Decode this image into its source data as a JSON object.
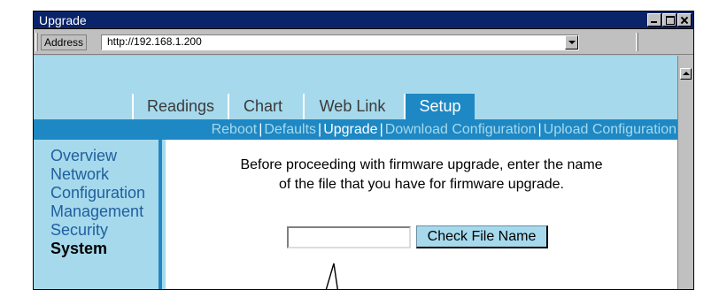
{
  "window": {
    "title": "Upgrade"
  },
  "address": {
    "label": "Address",
    "url": "http://192.168.1.200"
  },
  "tabs": [
    {
      "label": "Readings",
      "active": false
    },
    {
      "label": "Chart",
      "active": false
    },
    {
      "label": "Web Link",
      "active": false
    },
    {
      "label": "Setup",
      "active": true
    }
  ],
  "subnav": [
    {
      "label": "Reboot",
      "selected": false
    },
    {
      "label": "Defaults",
      "selected": false
    },
    {
      "label": "Upgrade",
      "selected": true
    },
    {
      "label": "Download Configuration",
      "selected": false
    },
    {
      "label": "Upload Configuration",
      "selected": false
    }
  ],
  "sidebar": {
    "items": [
      {
        "label": "Overview"
      },
      {
        "label": "Network"
      },
      {
        "label": "Configuration"
      },
      {
        "label": "Management"
      },
      {
        "label": "Security"
      },
      {
        "label": "System"
      }
    ]
  },
  "main": {
    "instruction_line1": "Before proceeding with firmware upgrade, enter the name",
    "instruction_line2": "of the file that you have for firmware upgrade.",
    "file_input_value": "",
    "check_button_label": "Check File Name"
  },
  "icons": {
    "minimize": "minimize-icon",
    "maximize": "maximize-icon",
    "close": "close-icon",
    "address_dropdown": "chevron-down-icon",
    "scroll_up": "chevron-up-icon",
    "callout": "arrow-up-icon"
  },
  "colors": {
    "titlebar": "#0a246a",
    "content_bg": "#a6d9ec",
    "accent_blue": "#1e88c4",
    "link_blue": "#1f5f9e"
  }
}
